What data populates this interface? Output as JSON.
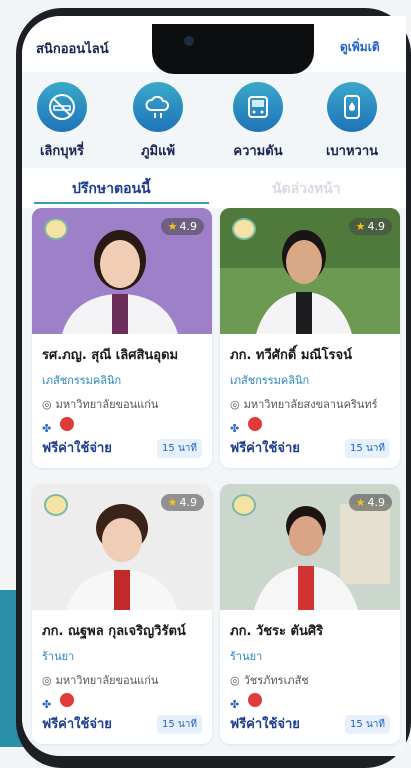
{
  "header": {
    "title": "สนิกออนไลน์",
    "link": "ดูเพิ่มเติ"
  },
  "categories": [
    {
      "label": "เลิกบุหรี่",
      "icon": "no-smoking-icon"
    },
    {
      "label": "ภูมิแพ้",
      "icon": "allergy-cloud-icon"
    },
    {
      "label": "ความดัน",
      "icon": "blood-pressure-monitor-icon"
    },
    {
      "label": "เบาหวาน",
      "icon": "glucose-meter-icon"
    }
  ],
  "tabs": {
    "active": "ปรึกษาตอนนี้",
    "inactive": "นัดล่วงหน้า"
  },
  "doctors": [
    {
      "name": "รศ.ภญ. สุณี เลิศสินอุดม",
      "specialty": "เภสัชกรรมคลินิก",
      "location": "มหาวิทยาลัยขอนแก่น",
      "rating": "4.9",
      "price": "ฟรีค่าใช้จ่าย",
      "duration": "15 นาที",
      "photo_bg": "#9c7ec3"
    },
    {
      "name": "ภก. ทวีศักดิ์ มณีโรจน์",
      "specialty": "เภสัชกรรมคลินิก",
      "location": "มหาวิทยาลัยสงขลานครินทร์",
      "rating": "4.9",
      "price": "ฟรีค่าใช้จ่าย",
      "duration": "15 นาที",
      "photo_bg": "#6c9a52"
    },
    {
      "name": "ภก. ณฐพล กุลเจริญวิรัตน์",
      "specialty": "ร้านยา",
      "location": "มหาวิทยาลัยขอนแก่น",
      "rating": "4.9",
      "price": "ฟรีค่าใช้จ่าย",
      "duration": "15 นาที",
      "photo_bg": "#ececec"
    },
    {
      "name": "ภก. วัชระ ตันศิริ",
      "specialty": "ร้านยา",
      "location": "วัชรภัทรเภสัช",
      "rating": "4.9",
      "price": "ฟรีค่าใช้จ่าย",
      "duration": "15 นาที",
      "photo_bg": "#cdd8cf"
    }
  ]
}
